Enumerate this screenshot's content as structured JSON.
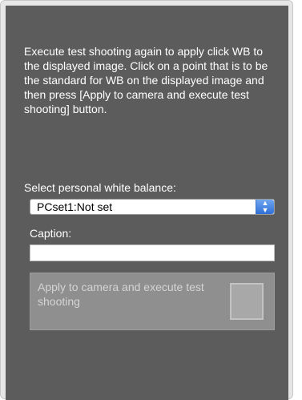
{
  "instructions": "Execute test shooting again to apply click WB to the displayed image. Click on a point that is to be the standard for WB on the displayed image and then press [Apply to camera and execute test shooting] button.",
  "personal_wb": {
    "label": "Select personal white balance:",
    "selected": "PCset1:Not set"
  },
  "caption": {
    "label": "Caption:",
    "value": ""
  },
  "apply_button": {
    "label": "Apply to camera and execute test shooting"
  }
}
